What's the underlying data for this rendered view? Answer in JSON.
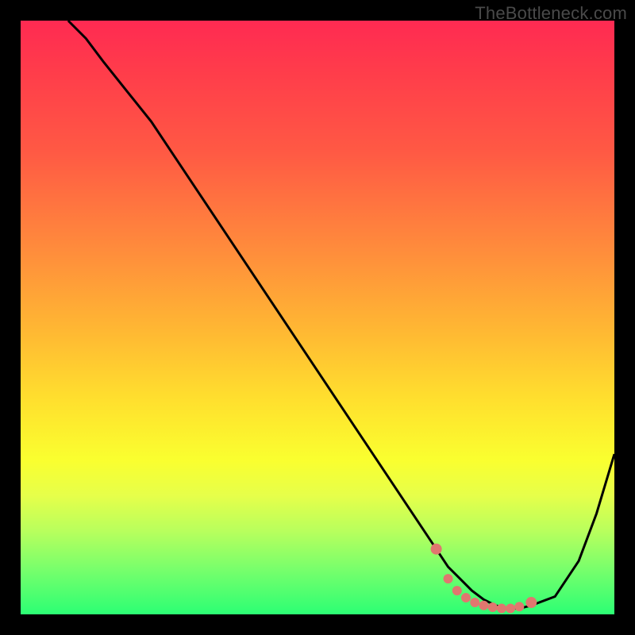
{
  "watermark": "TheBottleneck.com",
  "chart_data": {
    "type": "line",
    "title": "",
    "xlabel": "",
    "ylabel": "",
    "xlim": [
      0,
      100
    ],
    "ylim": [
      0,
      100
    ],
    "x": [
      8,
      11,
      14,
      18,
      22,
      26,
      30,
      34,
      38,
      42,
      46,
      50,
      54,
      58,
      62,
      66,
      70,
      72,
      74,
      76,
      78,
      80,
      82,
      84,
      86,
      90,
      94,
      97,
      100
    ],
    "values": [
      100,
      97,
      93,
      88,
      83,
      77,
      71,
      65,
      59,
      53,
      47,
      41,
      35,
      29,
      23,
      17,
      11,
      8,
      6,
      4,
      2.5,
      1.5,
      1,
      1,
      1.5,
      3,
      9,
      17,
      27
    ],
    "highlight_points": {
      "x": [
        70,
        72,
        73.5,
        75,
        76.5,
        78,
        79.5,
        81,
        82.5,
        84,
        86
      ],
      "values": [
        11,
        6,
        4,
        2.8,
        2,
        1.5,
        1.2,
        1,
        1,
        1.3,
        2
      ]
    },
    "colors": {
      "line": "#000000",
      "highlight": "#e0776f"
    }
  }
}
